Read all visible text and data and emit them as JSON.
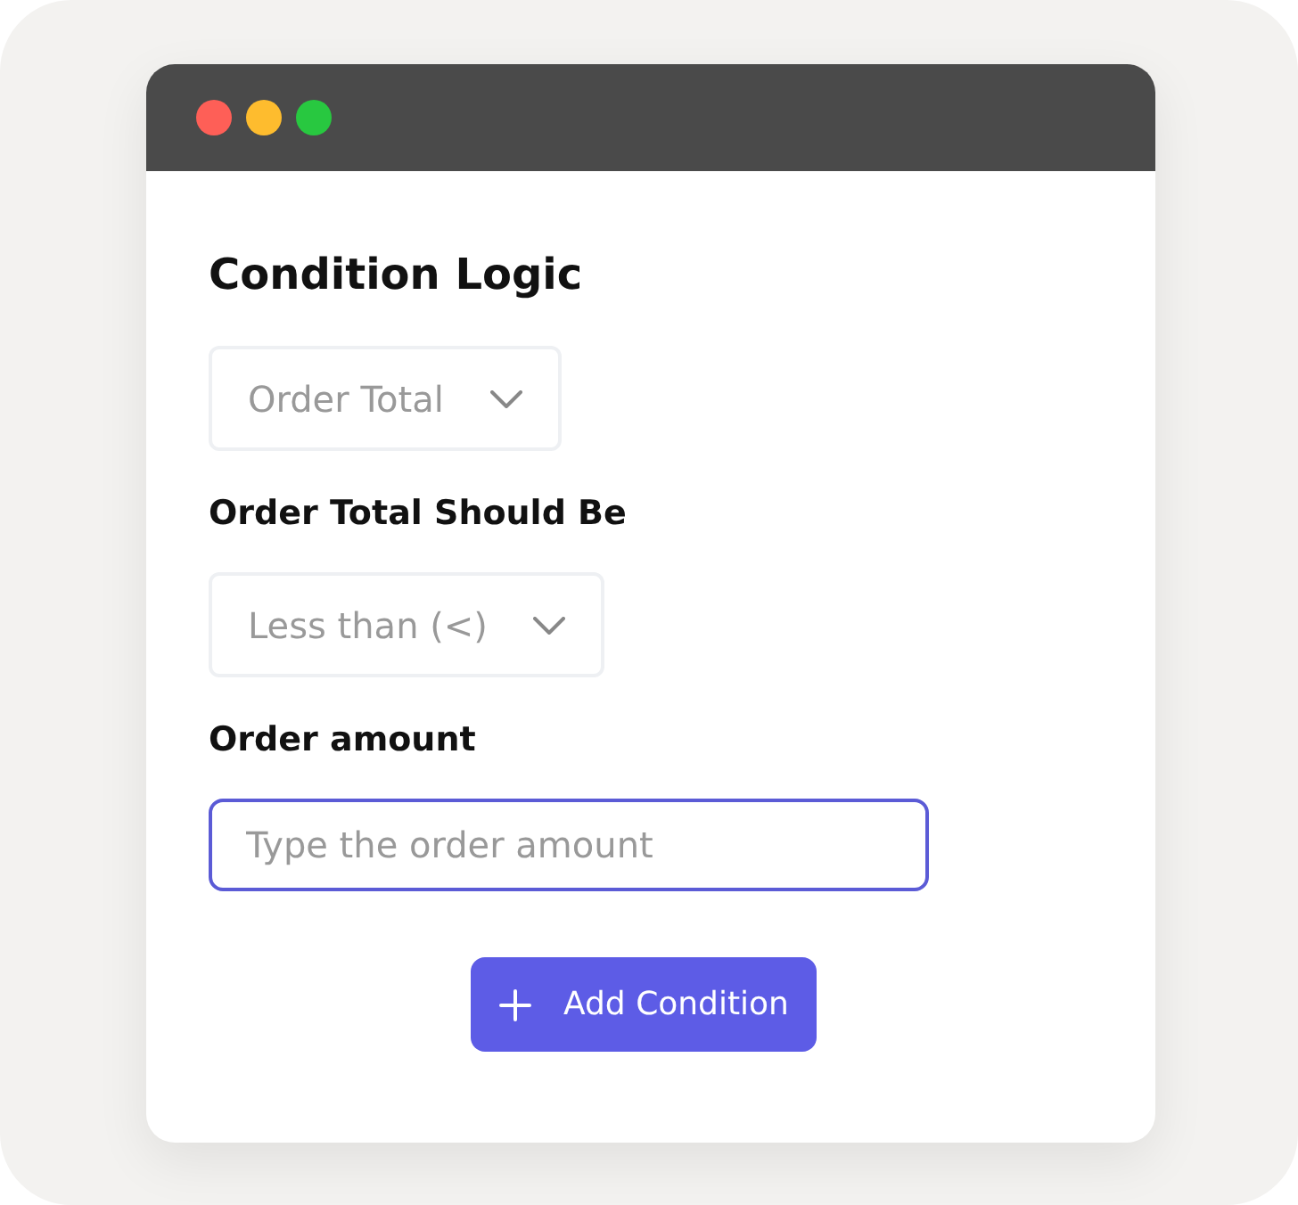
{
  "panel": {
    "title": "Condition Logic",
    "fields": [
      {
        "kind": "select",
        "value": "Order Total"
      },
      {
        "kind": "label",
        "text": "Order Total Should Be"
      },
      {
        "kind": "select",
        "value": "Less than (<)"
      },
      {
        "kind": "label",
        "text": "Order amount"
      },
      {
        "kind": "input",
        "placeholder": "Type the order amount"
      }
    ],
    "button": {
      "label": "Add Condition"
    }
  }
}
